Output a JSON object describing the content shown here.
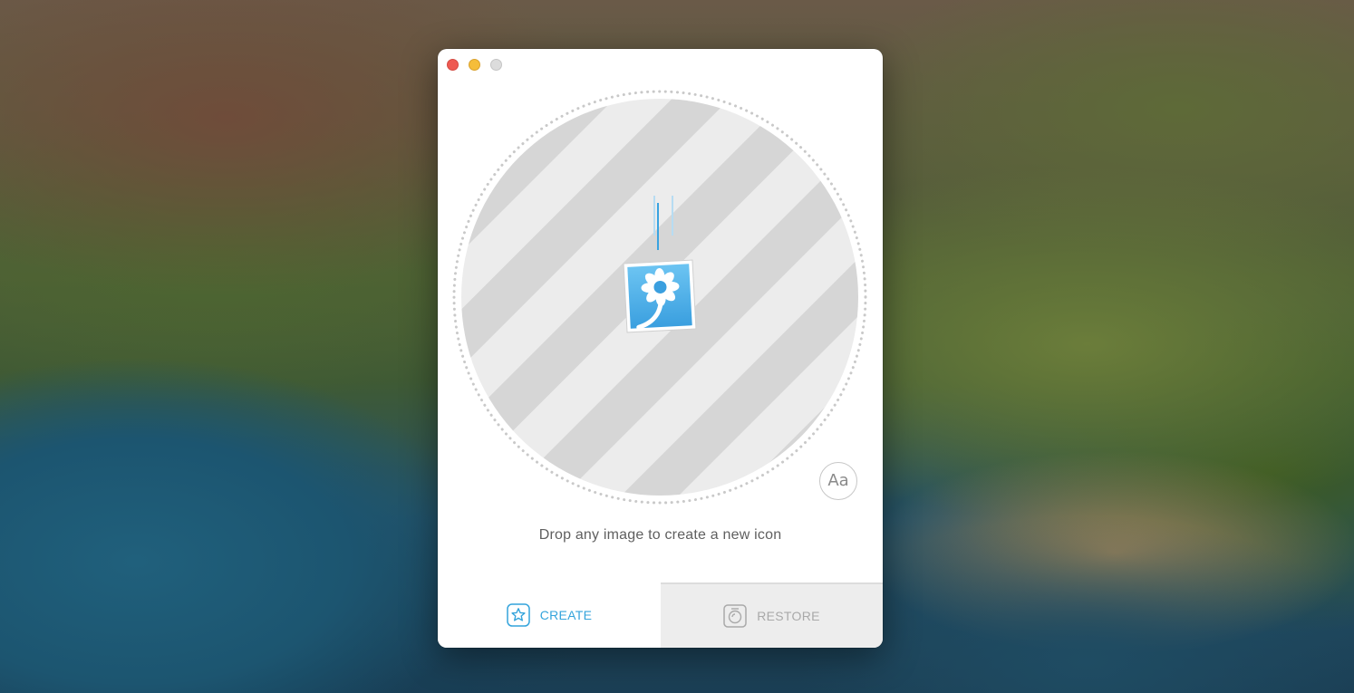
{
  "window": {
    "controls": {
      "close": "close-button",
      "minimize": "minimize-button",
      "zoom": "zoom-button"
    }
  },
  "drop_zone": {
    "icon": "flower-image-icon",
    "hint": "Drop any image to create a new icon",
    "text_style_button_label": "Aa"
  },
  "tabs": [
    {
      "label": "CREATE",
      "icon": "star-icon",
      "active": true
    },
    {
      "label": "RESTORE",
      "icon": "restore-icon",
      "active": false
    }
  ],
  "colors": {
    "accent": "#34a4dc",
    "close": "#ee5a52",
    "minimize": "#f5bd3a",
    "zoom": "#dcdcdc",
    "stripe_dark": "#d6d6d6",
    "stripe_light": "#ececec",
    "inactive_tab": "#ededed"
  }
}
